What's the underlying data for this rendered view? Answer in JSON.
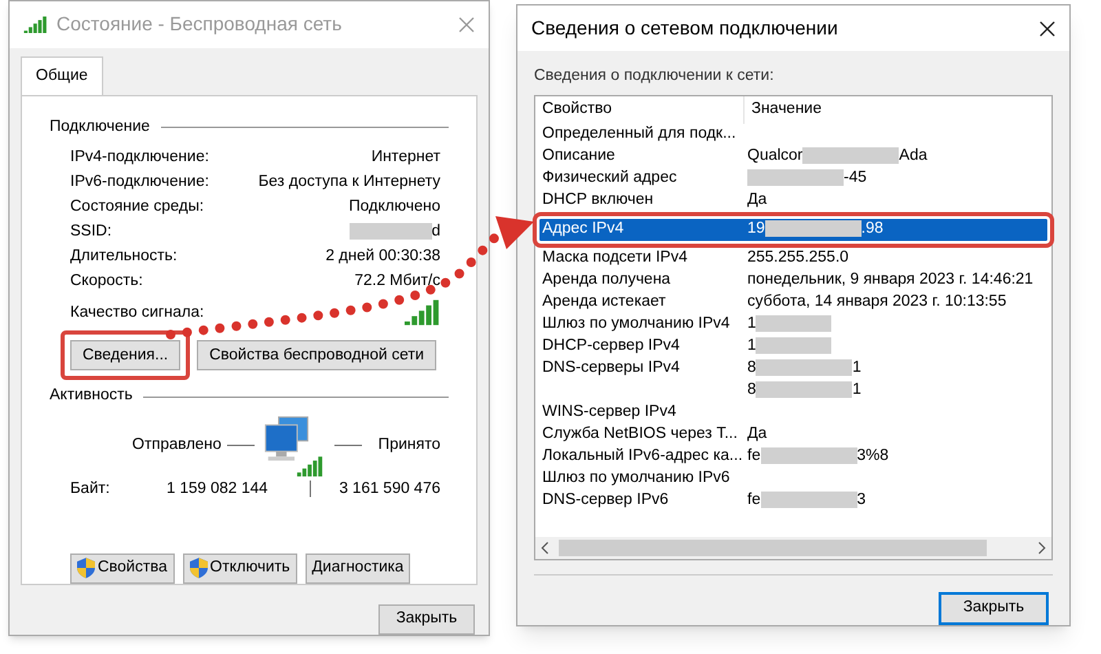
{
  "status_window": {
    "title": "Состояние - Беспроводная сеть",
    "tabs": [
      {
        "label": "Общие",
        "selected": true
      }
    ],
    "connection": {
      "heading": "Подключение",
      "rows": [
        {
          "label": "IPv4-подключение:",
          "value": "Интернет"
        },
        {
          "label": "IPv6-подключение:",
          "value": "Без доступа к Интернету"
        },
        {
          "label": "Состояние среды:",
          "value": "Подключено"
        },
        {
          "label": "SSID:",
          "value": "d",
          "redacted": true
        },
        {
          "label": "Длительность:",
          "value": "2 дней 00:30:38"
        },
        {
          "label": "Скорость:",
          "value": "72.2 Мбит/с"
        }
      ],
      "signal_label": "Качество сигнала:",
      "buttons": [
        {
          "label": "Сведения...",
          "highlighted": true
        },
        {
          "label": "Свойства беспроводной сети",
          "highlighted": false
        }
      ]
    },
    "activity": {
      "heading": "Активность",
      "sent_label": "Отправлено",
      "received_label": "Принято",
      "bytes_label": "Байт:",
      "bytes_sent": "1 159 082 144",
      "bytes_received": "3 161 590 476"
    },
    "buttons": [
      {
        "label": "Свойства",
        "shield": true
      },
      {
        "label": "Отключить",
        "shield": true
      },
      {
        "label": "Диагностика",
        "shield": false
      }
    ],
    "close_button": "Закрыть"
  },
  "details_window": {
    "title": "Сведения о сетевом подключении",
    "list_label": "Сведения о подключении к сети:",
    "columns": [
      "Свойство",
      "Значение"
    ],
    "rows": [
      {
        "property": "Определенный для подк...",
        "selected": false
      },
      {
        "property": "Описание",
        "value_parts": [
          "Qualcor",
          "Ada"
        ],
        "selected": false
      },
      {
        "property": "Физический адрес",
        "value_parts": [
          "-45"
        ],
        "blur_lead": true,
        "selected": false
      },
      {
        "property": "DHCP включен",
        "value_parts": [
          "Да"
        ],
        "selected": false
      },
      {
        "property": "Адрес IPv4",
        "value_parts": [
          "19",
          ".98"
        ],
        "selected": true
      },
      {
        "property": "Маска подсети IPv4",
        "value_parts": [
          "255.255.255.0"
        ],
        "selected": false
      },
      {
        "property": "Аренда получена",
        "value_parts": [
          "понедельник, 9 января 2023 г. 14:46:21"
        ],
        "selected": false
      },
      {
        "property": "Аренда истекает",
        "value_parts": [
          "суббота, 14 января 2023 г. 10:13:55"
        ],
        "selected": false
      },
      {
        "property": "Шлюз по умолчанию IPv4",
        "value_parts": [
          "1"
        ],
        "blur_tail": true,
        "selected": false
      },
      {
        "property": "DHCP-сервер IPv4",
        "value_parts": [
          "1"
        ],
        "blur_tail": true,
        "selected": false
      },
      {
        "property": "DNS-серверы IPv4",
        "value_parts": [
          "8",
          "1"
        ],
        "selected": false
      },
      {
        "value_parts": [
          "8",
          "1"
        ],
        "selected": false
      },
      {
        "property": "WINS-сервер IPv4",
        "selected": false
      },
      {
        "property": "Служба NetBIOS через Т...",
        "value_parts": [
          "Да"
        ],
        "selected": false
      },
      {
        "property": "Локальный IPv6-адрес ка...",
        "value_parts": [
          "fe",
          "3%8"
        ],
        "selected": false
      },
      {
        "property": "Шлюз по умолчанию IPv6",
        "selected": false
      },
      {
        "property": "DNS-сервер IPv6",
        "value_parts": [
          "fe",
          "3"
        ],
        "selected": false
      }
    ],
    "close_button": "Закрыть"
  }
}
